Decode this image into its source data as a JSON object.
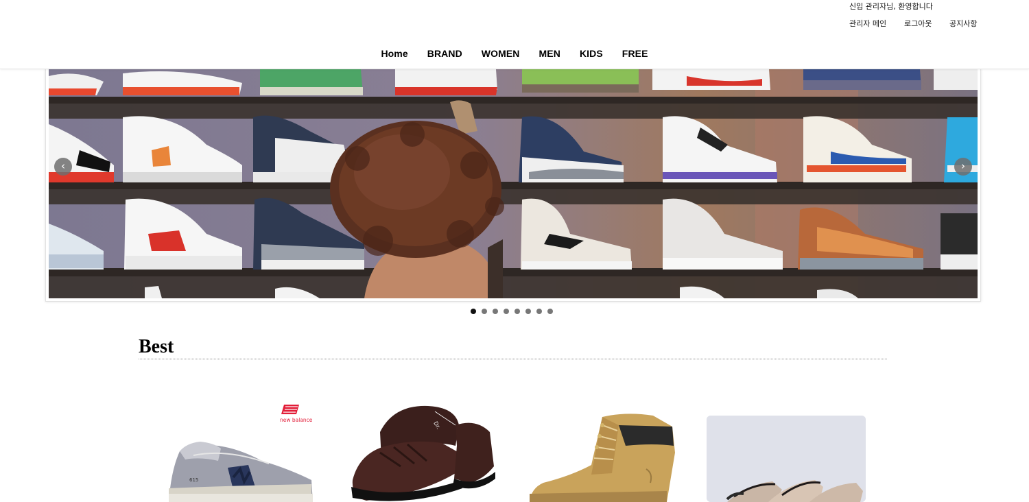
{
  "header": {
    "welcome": "신입 관리자님, 환영합니다",
    "util_links": [
      "관리자 메인",
      "로그아웃",
      "공지사항"
    ],
    "nav": [
      "Home",
      "BRAND",
      "WOMEN",
      "MEN",
      "KIDS",
      "FREE"
    ]
  },
  "slider": {
    "prev_icon": "chevron-left-icon",
    "next_icon": "chevron-right-icon",
    "prev_glyph": "‹",
    "next_glyph": "›",
    "slide_count": 8,
    "active_index": 0
  },
  "best": {
    "title": "Best",
    "products": [
      {
        "image": "new-balance-615-sneaker",
        "brand_logo": "new balance"
      },
      {
        "image": "brown-leather-sandal"
      },
      {
        "image": "wheat-work-boot"
      },
      {
        "image": "heeled-mules-photo"
      }
    ]
  }
}
